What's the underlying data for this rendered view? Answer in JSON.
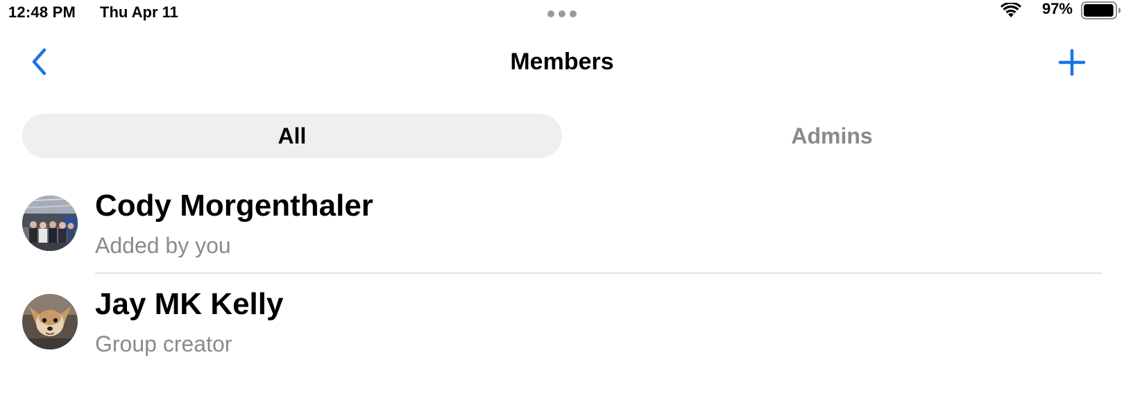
{
  "status_bar": {
    "time": "12:48 PM",
    "date": "Thu Apr 11",
    "battery_percent": "97%",
    "battery_level": 0.97,
    "icons": [
      "multitask-dots-icon",
      "wifi-icon",
      "battery-icon"
    ]
  },
  "nav": {
    "title": "Members",
    "back_icon": "chevron-left-icon",
    "add_icon": "plus-icon"
  },
  "tabs": [
    {
      "label": "All",
      "selected": true
    },
    {
      "label": "Admins",
      "selected": false
    }
  ],
  "members": [
    {
      "name": "Cody Morgenthaler",
      "subtitle": "Added by you",
      "avatar": "group-photo-avatar"
    },
    {
      "name": "Jay MK Kelly",
      "subtitle": "Group creator",
      "avatar": "dog-photo-avatar"
    }
  ],
  "colors": {
    "accent": "#1a73e8",
    "secondary_text": "#8a8a8a",
    "selected_tab_bg": "#efefef",
    "divider": "#e4e4e4"
  }
}
